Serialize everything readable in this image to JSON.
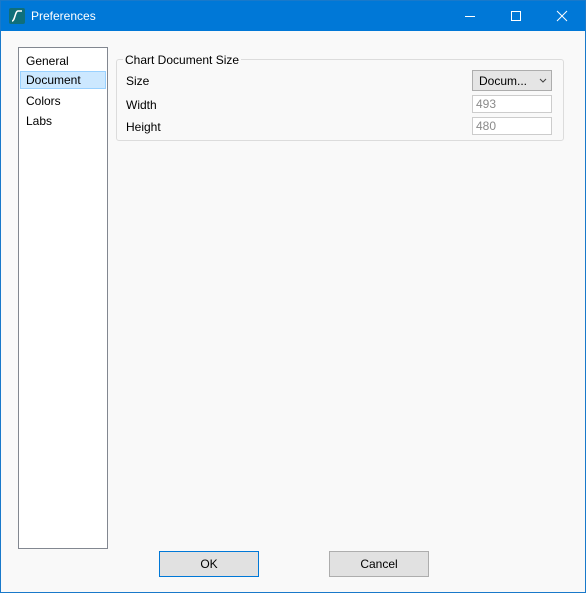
{
  "window": {
    "title": "Preferences",
    "app_icon": "chart-line-icon",
    "controls": [
      "minimize-icon",
      "maximize-icon",
      "close-icon"
    ]
  },
  "nav": {
    "items": [
      {
        "label": "General",
        "selected": false
      },
      {
        "label": "Document",
        "selected": true
      },
      {
        "label": "Colors",
        "selected": false
      },
      {
        "label": "Labs",
        "selected": false
      }
    ]
  },
  "document_panel": {
    "group_title": "Chart Document Size",
    "size_label": "Size",
    "size_value": "Docum...",
    "width_label": "Width",
    "width_value": "493",
    "height_label": "Height",
    "height_value": "480"
  },
  "buttons": {
    "ok": "OK",
    "cancel": "Cancel"
  },
  "colors": {
    "titlebar": "#0078d7",
    "selection": "#cce8ff"
  }
}
